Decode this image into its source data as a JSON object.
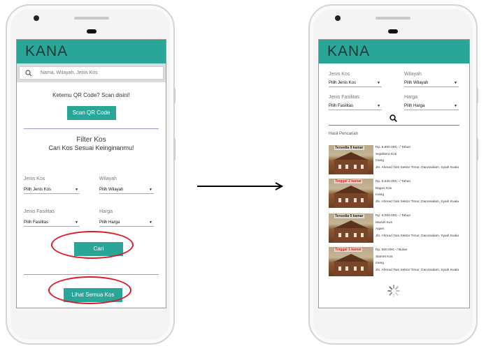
{
  "left_screen": {
    "app_title": "KANA",
    "search_placeholder": "Nama, Wilayah, Jenis Kos",
    "qr_prompt": "Ketemu QR Code? Scan disini!",
    "scan_button": "Scan QR Code",
    "filter_title": "Filter Kos",
    "filter_subtitle": "Cari Kos Sesuai Keinginanmu!",
    "filters": {
      "jenis_kos": {
        "label": "Jenis Kos",
        "value": "Pilih Jenis Kos"
      },
      "wilayah": {
        "label": "Wilayah",
        "value": "Pilih Wilayah"
      },
      "jenis_fasilitas": {
        "label": "Jenis Fasilitas",
        "value": "Pilih Fasilitas"
      },
      "harga": {
        "label": "Harga",
        "value": "Pilih Harga"
      }
    },
    "search_button": "Cari",
    "view_all_button": "Lihat Semua Kos"
  },
  "right_screen": {
    "app_title": "KANA",
    "filters": {
      "jenis_kos": {
        "label": "Jenis Kos",
        "value": "Pilih Jenis Kos"
      },
      "wilayah": {
        "label": "Wilayah",
        "value": "Pilih Wilayah"
      },
      "jenis_fasilitas": {
        "label": "Jenis Fasilitas",
        "value": "Pilih Fasilitas"
      },
      "harga": {
        "label": "Harga",
        "value": "Pilih Harga"
      }
    },
    "results_label": "Hasil Pencarian",
    "results": [
      {
        "badge": "Tersedia 9 kamar",
        "price": "Rp. 5.800.000,- / Tahun",
        "name": "Sejahtera Kos",
        "type": "Inang",
        "address": "Jln. Ahmad Yani Sektor Timur, Darussalam, Syiah Kuala"
      },
      {
        "badge": "Tinggal 2 kamar",
        "price": "Rp. 5.530.000,- / Tahun",
        "name": "Bagus Kos",
        "type": "Inang",
        "address": "Jln. Ahmad Yani Sektor Timur, Darussalam, Syiah Kuala"
      },
      {
        "badge": "Tersedia 5 kamar",
        "price": "Rp. 6.000.000,- / Tahun",
        "name": "Marvel Kos",
        "type": "Agam",
        "address": "Jln. Ahmad Yani Sektor Timur, Darussalam, Syiah Kuala"
      },
      {
        "badge": "Tinggal 1 kamar",
        "price": "Rp. 500.000,- / Bulan",
        "name": "Slamet Kos",
        "type": "Inang",
        "address": "Jln. Ahmad Yani Sektor Timur, Darussalam, Syiah Kuala"
      }
    ]
  },
  "colors": {
    "accent": "#2aa699",
    "highlight": "#e0192a",
    "badge_red": "#d8252d"
  },
  "icons": [
    "search-icon",
    "caret-down-icon",
    "arrow-right-icon",
    "loading-spinner-icon"
  ]
}
